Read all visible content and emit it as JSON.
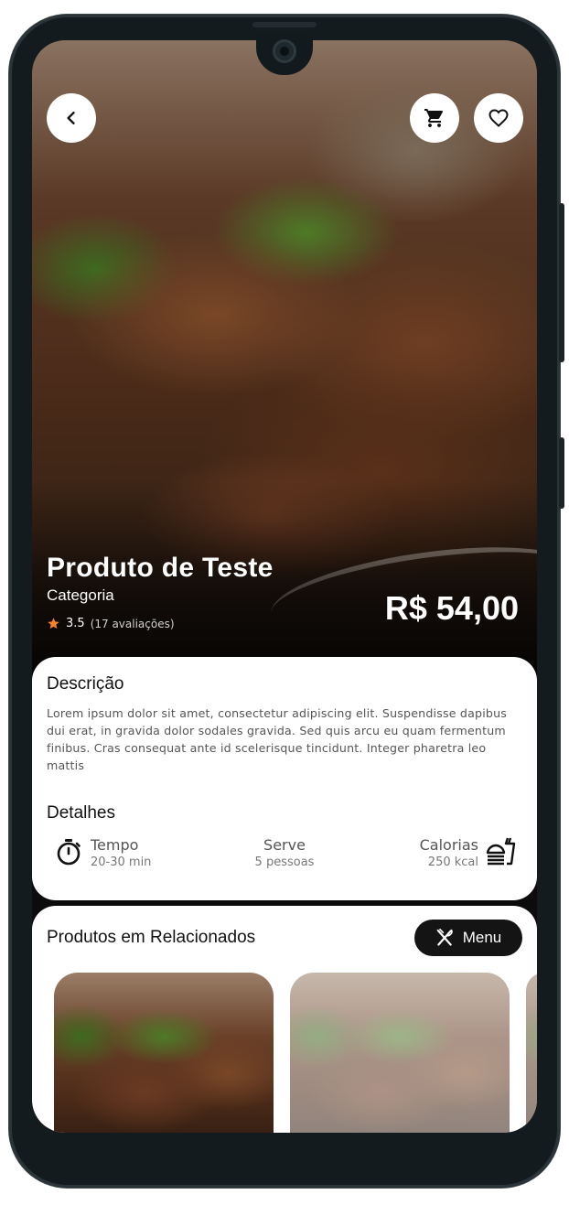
{
  "hero": {
    "back_icon": "chevron-left-icon",
    "cart_icon": "cart-icon",
    "favorite_icon": "heart-outline-icon",
    "product_title": "Produto de Teste",
    "category": "Categoria",
    "rating_score": "3.5",
    "rating_reviews": "(17 avaliações)",
    "price": "R$ 54,00",
    "star_color": "#f5822a"
  },
  "description": {
    "title": "Descrição",
    "text": "Lorem ipsum dolor sit amet, consectetur adipiscing elit. Suspendisse dapibus dui erat, in gravida dolor sodales gravida. Sed quis arcu eu quam fermentum finibus. Cras consequat ante id scelerisque tincidunt. Integer pharetra leo mattis"
  },
  "details": {
    "title": "Detalhes",
    "items": [
      {
        "label": "Tempo",
        "value": "20-30 min",
        "icon": "stopwatch-icon"
      },
      {
        "label": "Serve",
        "value": "5 pessoas"
      },
      {
        "label": "Calorias",
        "value": "250 kcal",
        "icon": "fastfood-icon"
      }
    ]
  },
  "related": {
    "title": "Produtos em Relacionados",
    "menu_label": "Menu",
    "menu_icon": "fork-knife-icon"
  }
}
